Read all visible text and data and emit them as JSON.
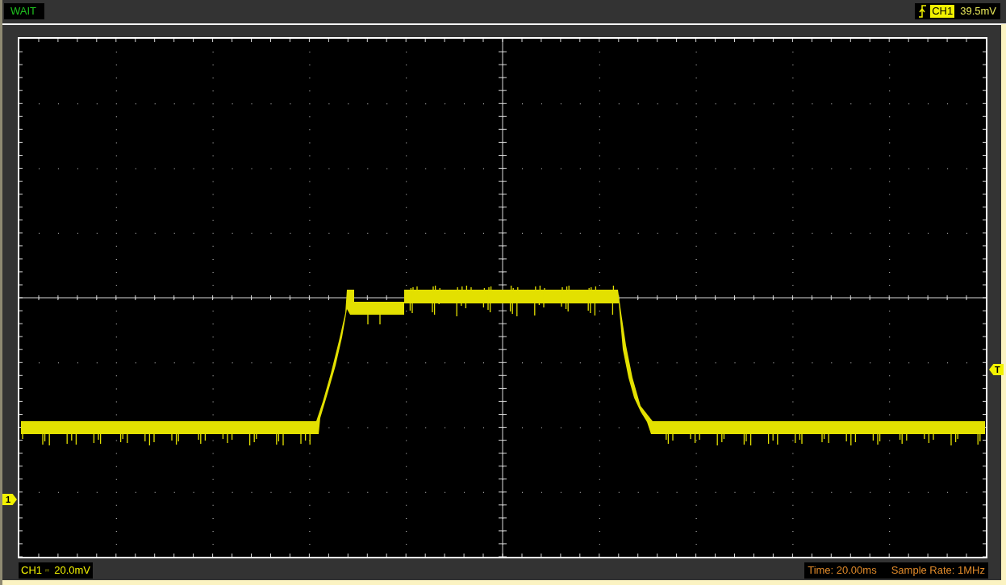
{
  "status": "WAIT",
  "trigger": {
    "channel": "CH1",
    "level": "39.5mV"
  },
  "channel_marker": "1",
  "trigger_marker": "T",
  "channel_scale": {
    "channel": "CH1",
    "volts_per_div": "20.0mV"
  },
  "timebase": "Time: 20.00ms",
  "sample_rate": "Sample Rate: 1MHz"
}
